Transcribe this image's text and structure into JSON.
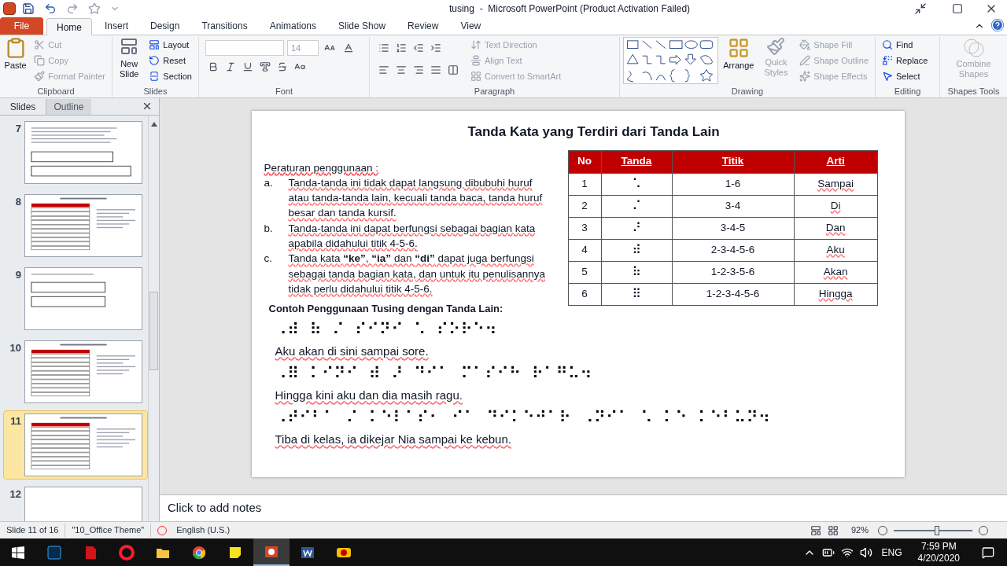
{
  "window": {
    "title": "tusing  -  Microsoft PowerPoint (Product Activation Failed)"
  },
  "tabs": [
    {
      "label": "File",
      "kind": "file",
      "selected": false
    },
    {
      "label": "Home",
      "kind": "tab",
      "selected": true
    },
    {
      "label": "Insert",
      "kind": "tab",
      "selected": false
    },
    {
      "label": "Design",
      "kind": "tab",
      "selected": false
    },
    {
      "label": "Transitions",
      "kind": "tab",
      "selected": false
    },
    {
      "label": "Animations",
      "kind": "tab",
      "selected": false
    },
    {
      "label": "Slide Show",
      "kind": "tab",
      "selected": false
    },
    {
      "label": "Review",
      "kind": "tab",
      "selected": false
    },
    {
      "label": "View",
      "kind": "tab",
      "selected": false
    }
  ],
  "ribbon": {
    "clipboard": {
      "label": "Clipboard",
      "paste": "Paste",
      "items": [
        {
          "label": "Cut",
          "kind": "cut",
          "disabled": true
        },
        {
          "label": "Copy",
          "kind": "copy",
          "disabled": true
        },
        {
          "label": "Format Painter",
          "kind": "painter",
          "disabled": true
        }
      ]
    },
    "slides": {
      "label": "Slides",
      "new_slide": "New Slide",
      "items": [
        {
          "label": "Layout",
          "kind": "layout"
        },
        {
          "label": "Reset",
          "kind": "reset"
        },
        {
          "label": "Section",
          "kind": "section"
        }
      ]
    },
    "font": {
      "label": "Font",
      "size": "14"
    },
    "paragraph": {
      "label": "Paragraph",
      "items": [
        {
          "label": "Text Direction",
          "kind": "direction",
          "disabled": true
        },
        {
          "label": "Align Text",
          "kind": "align",
          "disabled": true
        },
        {
          "label": "Convert to SmartArt",
          "kind": "smartart",
          "disabled": true
        }
      ]
    },
    "drawing": {
      "label": "Drawing",
      "arrange": "Arrange",
      "quick_styles": {
        "label": "Quick Styles",
        "disabled": true
      },
      "items": [
        {
          "label": "Shape Fill",
          "kind": "fill",
          "disabled": true
        },
        {
          "label": "Shape Outline",
          "kind": "outline",
          "disabled": true
        },
        {
          "label": "Shape Effects",
          "kind": "effects",
          "disabled": true
        }
      ]
    },
    "editing": {
      "label": "Editing",
      "items": [
        {
          "label": "Find",
          "kind": "find"
        },
        {
          "label": "Replace",
          "kind": "replace"
        },
        {
          "label": "Select",
          "kind": "select"
        }
      ]
    },
    "shapes_tools": {
      "label": "Shapes Tools",
      "combine": {
        "label": "Combine Shapes",
        "disabled": true
      }
    }
  },
  "panel_tabs": [
    {
      "label": "Slides",
      "selected": true
    },
    {
      "label": "Outline",
      "selected": false
    }
  ],
  "thumbnails": [
    {
      "number": "7",
      "kind": "text",
      "selected": false
    },
    {
      "number": "8",
      "kind": "table",
      "selected": false
    },
    {
      "number": "9",
      "kind": "boxes",
      "selected": false
    },
    {
      "number": "10",
      "kind": "table",
      "selected": false
    },
    {
      "number": "11",
      "kind": "table",
      "selected": true
    },
    {
      "number": "12",
      "kind": "blank",
      "selected": false
    }
  ],
  "slide": {
    "title": "Tanda Kata yang Terdiri dari Tanda Lain",
    "rules": {
      "heading": "Peraturan penggunaan  :",
      "items": [
        {
          "marker": "a.",
          "text": "Tanda-tanda ini tidak dapat langsung dibubuhi huruf atau tanda-tanda lain, kecuali tanda baca, tanda huruf besar dan tanda kursif."
        },
        {
          "marker": "b.",
          "text": "Tanda-tanda ini dapat berfungsi sebagai bagian kata apabila didahului titik 4-5-6."
        },
        {
          "marker": "c.",
          "text": "Tanda kata **“ke”**, **“ia”** dan **“di”**  dapat juga berfungsi sebagai tanda bagian kata, dan untuk itu penulisannya tidak perlu didahului titik 4-5-6."
        }
      ]
    },
    "table": {
      "columns": [
        "No",
        "Tanda",
        "Titik",
        "Arti"
      ],
      "rows": [
        [
          "1",
          "⠡",
          "1-6",
          "Sampai"
        ],
        [
          "2",
          "⠌",
          "3-4",
          "Di"
        ],
        [
          "3",
          "⠜",
          "3-4-5",
          "Dan"
        ],
        [
          "4",
          "⠾",
          "2-3-4-5-6",
          "Aku"
        ],
        [
          "5",
          "⠷",
          "1-2-3-5-6",
          "Akan"
        ],
        [
          "6",
          "⠿",
          "1-2-3-4-5-6",
          "Hingga"
        ]
      ]
    },
    "examples_heading": "Contoh Penggunaan Tusing dengan Tanda Lain:",
    "examples": [
      {
        "braille": "⠠⠾  ⠷  ⠌  ⠎⠊⠝⠊  ⠡  ⠎⠕⠗⠑⠲",
        "text": "Aku akan di sini sampai sore."
      },
      {
        "braille": "⠠⠿  ⠅⠊⠝⠊  ⠾  ⠜  ⠙⠊⠁  ⠍⠁⠎⠊⠓  ⠗⠁⠛⠥⠲",
        "text": "Hingga kini aku dan dia masih ragu."
      },
      {
        "braille": "⠠⠞⠊⠃⠁  ⠌  ⠅⠑⠇⠁⠎⠂  ⠊⠁  ⠙⠊⠅⠑⠚⠁⠗  ⠠⠝⠊⠁  ⠡  ⠅⠑  ⠅⠑⠃⠥⠝⠲",
        "text": "Tiba di kelas, ia dikejar Nia sampai ke kebun."
      }
    ]
  },
  "notes": {
    "placeholder": "Click to add notes"
  },
  "status_bar": {
    "slide": "Slide 11 of 16",
    "theme": "\"10_Office Theme\"",
    "language": "English (U.S.)",
    "zoom": "92%",
    "level": 0.55
  },
  "taskbar": {
    "apps": [
      {
        "kind": "ps",
        "selected": false
      },
      {
        "kind": "pdf",
        "selected": false
      },
      {
        "kind": "opera",
        "selected": false
      },
      {
        "kind": "folder",
        "selected": false
      },
      {
        "kind": "chrome",
        "selected": false
      },
      {
        "kind": "notes",
        "selected": false
      },
      {
        "kind": "ppt",
        "selected": true
      },
      {
        "kind": "word",
        "selected": false
      },
      {
        "kind": "app",
        "selected": false
      }
    ],
    "language": "ENG",
    "time": "7:59 PM",
    "date": "4/20/2020"
  }
}
